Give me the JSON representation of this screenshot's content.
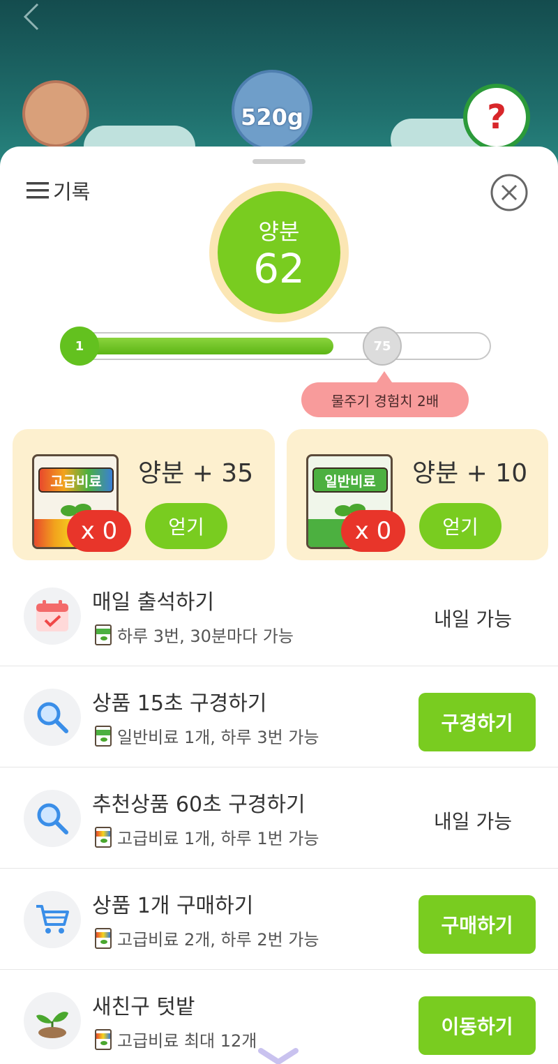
{
  "background": {
    "jar_amount": "520g"
  },
  "sheet": {
    "record_label": "기록",
    "nutrient": {
      "label": "양분",
      "value": "62"
    },
    "progress": {
      "start_level": "1",
      "milestone_level": "75",
      "fill_fraction": 0.62
    },
    "tooltip": "물주기 경험치 2배",
    "fertilizers": [
      {
        "bag_label": "고급비료",
        "title": "양분 + 35",
        "count": "x 0",
        "button": "얻기"
      },
      {
        "bag_label": "일반비료",
        "title": "양분 + 10",
        "count": "x 0",
        "button": "얻기"
      }
    ],
    "tasks": [
      {
        "title": "매일 출석하기",
        "subtitle": "하루 3번, 30분마다 가능",
        "status": "내일 가능",
        "bag": "normal"
      },
      {
        "title": "상품 15초 구경하기",
        "subtitle": "일반비료 1개, 하루 3번 가능",
        "button": "구경하기",
        "bag": "normal"
      },
      {
        "title": "추천상품 60초 구경하기",
        "subtitle": "고급비료 1개, 하루 1번 가능",
        "status": "내일 가능",
        "bag": "premium"
      },
      {
        "title": "상품 1개 구매하기",
        "subtitle": "고급비료 2개, 하루 2번 가능",
        "button": "구매하기",
        "bag": "premium"
      },
      {
        "title": "새친구 텃밭",
        "subtitle": "고급비료 최대 12개",
        "button": "이동하기",
        "bag": "premium"
      }
    ]
  },
  "colors": {
    "accent_green": "#79cc20",
    "badge_red": "#e8352a",
    "tooltip_pink": "#f89b9b",
    "card_bg": "#fdf0cf"
  }
}
